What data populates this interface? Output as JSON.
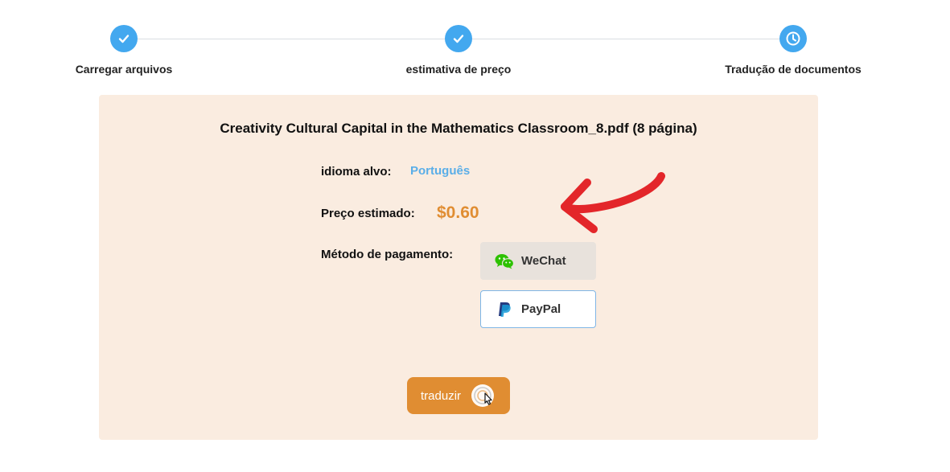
{
  "stepper": {
    "steps": [
      {
        "label": "Carregar arquivos",
        "status": "done",
        "icon": "check-icon"
      },
      {
        "label": "estimativa de preço",
        "status": "done",
        "icon": "check-icon"
      },
      {
        "label": "Tradução de documentos",
        "status": "current",
        "icon": "clock-icon"
      }
    ],
    "accent_color": "#43a8ef"
  },
  "card": {
    "file_title": "Creativity Cultural Capital in the Mathematics Classroom_8.pdf (8 página)",
    "target_language_label": "idioma alvo:",
    "target_language_value": "Português",
    "price_label": "Preço estimado:",
    "price_value": "$0.60",
    "payment_label": "Método de pagamento:",
    "payment_options": [
      {
        "label": "WeChat",
        "icon": "wechat-icon",
        "selected": true
      },
      {
        "label": "PayPal",
        "icon": "paypal-icon",
        "selected": false
      }
    ],
    "translate_button": "traduzir",
    "background_color": "#faece0",
    "price_color": "#e08d32",
    "language_color": "#5aaee8"
  },
  "annotation": {
    "icon": "red-curved-arrow-icon",
    "color": "#e3262a"
  }
}
